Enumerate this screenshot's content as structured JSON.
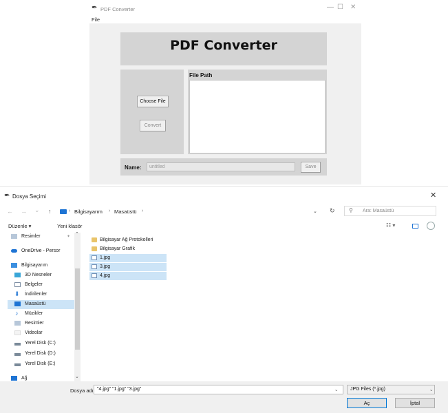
{
  "converter": {
    "window_title": "PDF Converter",
    "controls": {
      "minimize": "—",
      "maximize": "☐",
      "close": "✕"
    },
    "menu": {
      "file": "File"
    },
    "header_title": "PDF Converter",
    "buttons": {
      "choose_file": "Choose File",
      "convert": "Convert",
      "save": "Save"
    },
    "file_path_label": "File Path",
    "file_path_value": "",
    "name_label": "Name:",
    "name_value": "untitled"
  },
  "dialog": {
    "title": "Dosya Seçimi",
    "close": "✕",
    "nav": {
      "back": "←",
      "forward": "→",
      "recent": "⌄",
      "up": "↑"
    },
    "breadcrumb": [
      "Bilgisayarım",
      "Masaüstü"
    ],
    "breadcrumb_sep": "›",
    "address_dropdown": "⌄",
    "refresh": "↻",
    "search_placeholder": "Ara: Masaüstü",
    "toolbar": {
      "organize": "Düzenle ▾",
      "new_folder": "Yeni klasör",
      "view": "☷ ▾"
    },
    "sidebar": [
      {
        "label": "Resimler",
        "pin": "✦",
        "icon": "pictures-icon"
      },
      {
        "label": "OneDrive - Persor",
        "icon": "cloud-icon"
      },
      {
        "label": "Bilgisayarım",
        "icon": "computer-icon"
      },
      {
        "label": "3D Nesneler",
        "icon": "cube-icon"
      },
      {
        "label": "Belgeler",
        "icon": "document-icon"
      },
      {
        "label": "İndirilenler",
        "icon": "download-icon"
      },
      {
        "label": "Masaüstü",
        "icon": "desktop-icon",
        "selected": true
      },
      {
        "label": "Müzikler",
        "icon": "music-icon"
      },
      {
        "label": "Resimler",
        "icon": "pictures-icon"
      },
      {
        "label": "Videolar",
        "icon": "video-icon"
      },
      {
        "label": "Yerel Disk (C:)",
        "icon": "drive-icon"
      },
      {
        "label": "Yerel Disk (D:)",
        "icon": "drive-icon"
      },
      {
        "label": "Yerel Disk (E:)",
        "icon": "drive-icon"
      },
      {
        "label": "Ağ",
        "icon": "network-icon"
      }
    ],
    "files": [
      {
        "name": "Bilgisayar Ağ Protokolleri",
        "type": "folder"
      },
      {
        "name": "Bilgisayar Grafik",
        "type": "folder"
      },
      {
        "name": "1.jpg",
        "type": "image",
        "selected": true
      },
      {
        "name": "3.jpg",
        "type": "image",
        "selected": true
      },
      {
        "name": "4.jpg",
        "type": "image",
        "selected": true
      }
    ],
    "filename_label": "Dosya adı:",
    "filename_value": "\"4.jpg\" \"1.jpg\" \"3.jpg\"",
    "filetype_value": "JPG Files (*.jpg)",
    "open_button": "Aç",
    "cancel_button": "İptal",
    "colors": {
      "accent": "#0078d7",
      "selection": "#cce4f7",
      "folder": "#e9c46a"
    }
  }
}
